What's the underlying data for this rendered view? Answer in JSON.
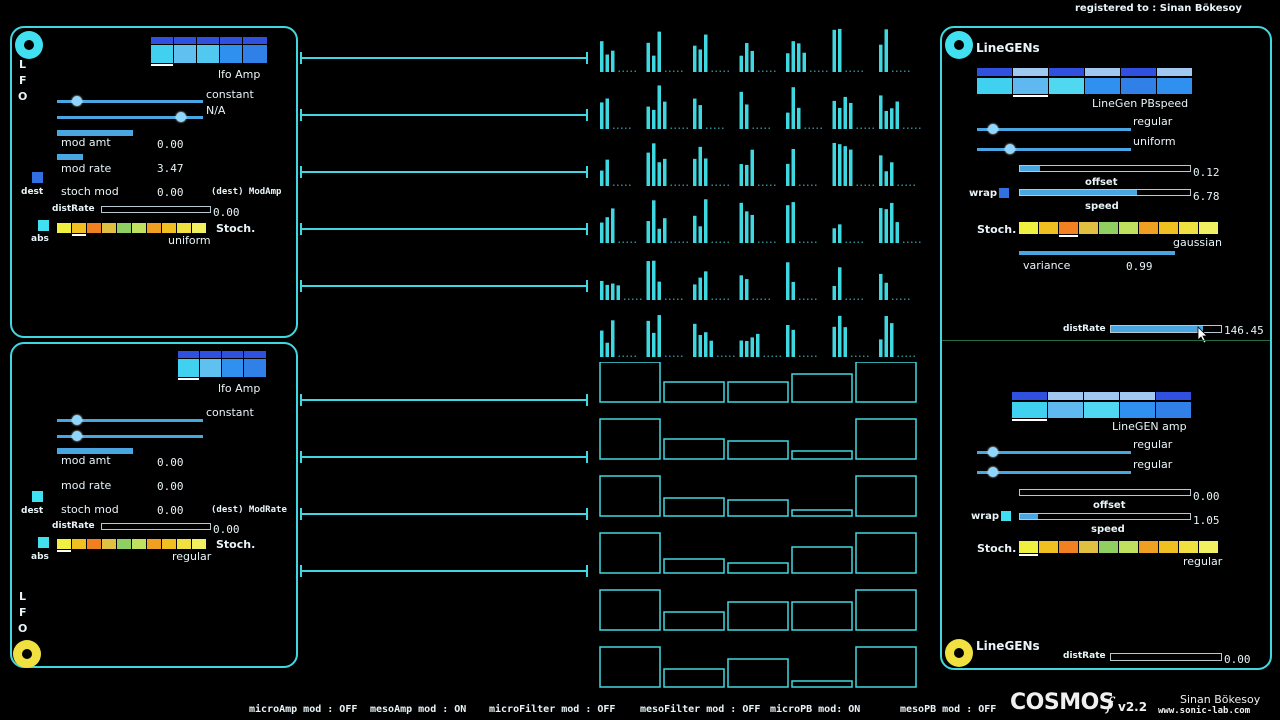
{
  "registered": "registered to : Sinan Bökesoy",
  "lfo1": {
    "side_letters": [
      "L",
      "F",
      "O"
    ],
    "title": "lfo  Amp",
    "mode1": "constant",
    "mode2": "N/A",
    "mod_amt_label": "mod  amt",
    "mod_amt_value": "0.00",
    "mod_rate_label": "mod  rate",
    "mod_rate_value": "3.47",
    "stoch_mod_label": "stoch  mod",
    "stoch_mod_value": "0.00",
    "dest_target": "(dest) ModAmp",
    "dest_label": "dest",
    "distrate_label": "distRate",
    "distrate_value": "0.00",
    "abs_label": "abs",
    "stoch_label": "Stoch.",
    "distribution": "uniform"
  },
  "lfo2": {
    "side_letters": [
      "L",
      "F",
      "O"
    ],
    "title": "lfo  Amp",
    "mode1": "constant",
    "mod_amt_label": "mod  amt",
    "mod_amt_value": "0.00",
    "mod_rate_label": "mod  rate",
    "mod_rate_value": "0.00",
    "stoch_mod_label": "stoch  mod",
    "stoch_mod_value": "0.00",
    "dest_target": "(dest) ModRate",
    "dest_label": "dest",
    "distrate_label": "distRate",
    "distrate_value": "0.00",
    "abs_label": "abs",
    "stoch_label": "Stoch.",
    "distribution": "regular"
  },
  "linegen1": {
    "header": "LineGENs",
    "title": "LineGen  PBspeed",
    "mode1": "regular",
    "mode2": "uniform",
    "offset_label": "offset",
    "offset_value": "0.12",
    "speed_label": "speed",
    "speed_value": "6.78",
    "wrap_label": "wrap",
    "stoch_label": "Stoch.",
    "distribution": "gaussian",
    "variance_label": "variance",
    "variance_value": "0.99",
    "distrate_label": "distRate",
    "distrate_value": "146.45"
  },
  "linegen2": {
    "title": "LineGEN  amp",
    "mode1": "regular",
    "mode2": "regular",
    "offset_label": "offset",
    "offset_value": "0.00",
    "speed_label": "speed",
    "speed_value": "1.05",
    "wrap_label": "wrap",
    "stoch_label": "Stoch.",
    "distribution": "regular",
    "footer": "LineGENs",
    "distrate_label": "distRate",
    "distrate_value": "0.00"
  },
  "status": {
    "microamp": "microAmp mod : OFF",
    "mesoamp": "mesoAmp mod  : ON",
    "microfilter": "microFilter mod : OFF",
    "mesofilter": "mesoFilter mod : OFF",
    "micropb": "microPB mod: ON",
    "mesopb": "mesoPB mod : OFF"
  },
  "logo": {
    "name": "COSMOS",
    "suffix": "f",
    "version": "v2.2",
    "author": "Sinan Bökesoy",
    "url": "www.sonic-lab.com"
  },
  "colors": {
    "accent": "#40d8e0",
    "slider": "#4aa6e0",
    "lfo_ring": "#40e0f0",
    "lfo2_ring": "#f0e040"
  }
}
